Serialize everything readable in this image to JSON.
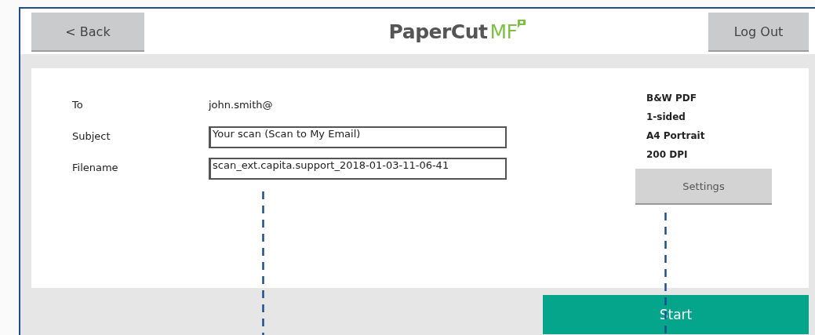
{
  "header": {
    "back_button": "< Back",
    "logo": {
      "text": "PaperCut",
      "accent": "MF"
    },
    "logout_button": "Log Out"
  },
  "form": {
    "fields": [
      {
        "label": "To",
        "kind": "text",
        "value": "john.smith@"
      },
      {
        "label": "Subject",
        "kind": "input",
        "value": "Your scan (Scan to My Email)"
      },
      {
        "label": "Filename",
        "kind": "input",
        "value": "scan_ext.capita.support_2018-01-03-11-06-41"
      }
    ]
  },
  "settings_summary": [
    "B&W PDF",
    "1-sided",
    "A4 Portrait",
    "200 DPI"
  ],
  "settings_button": "Settings",
  "start_button": "Start"
}
